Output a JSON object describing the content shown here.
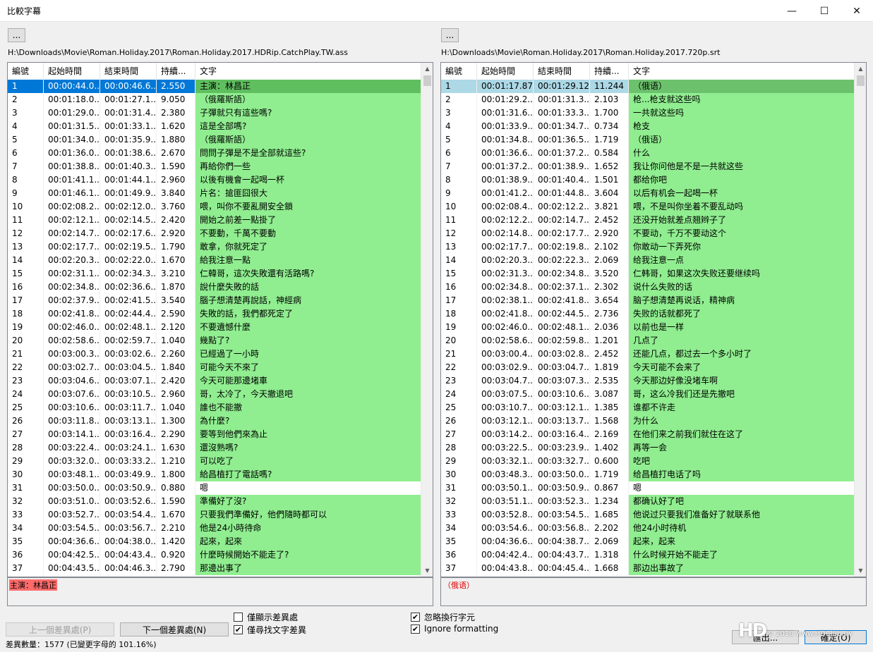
{
  "window": {
    "title": "比較字幕",
    "minimize": "—",
    "maximize": "☐",
    "close": "✕"
  },
  "left": {
    "browse_label": "...",
    "path": "H:\\Downloads\\Movie\\Roman.Holiday.2017\\Roman.Holiday.2017.HDRip.CatchPlay.TW.ass",
    "columns": [
      "編號",
      "起始時間",
      "結束時間",
      "持續...",
      "文字"
    ],
    "rows": [
      [
        "1",
        "00:00:44.0...",
        "00:00:46.6...",
        "2.550",
        "主演：林昌正"
      ],
      [
        "2",
        "00:01:18.0...",
        "00:01:27.1...",
        "9.050",
        "（俄羅斯語）"
      ],
      [
        "3",
        "00:01:29.0...",
        "00:01:31.4...",
        "2.380",
        "子彈就只有這些嗎?"
      ],
      [
        "4",
        "00:01:31.5...",
        "00:01:33.1...",
        "1.620",
        "這是全部嗎?"
      ],
      [
        "5",
        "00:01:34.0...",
        "00:01:35.9...",
        "1.880",
        "（俄羅斯語）"
      ],
      [
        "6",
        "00:01:36.0...",
        "00:01:38.6...",
        "2.670",
        "問問子彈是不是全部就這些?"
      ],
      [
        "7",
        "00:01:38.8...",
        "00:01:40.3...",
        "1.590",
        "再給你們一些"
      ],
      [
        "8",
        "00:01:41.1...",
        "00:01:44.1...",
        "2.960",
        "以後有機會一起喝一杯"
      ],
      [
        "9",
        "00:01:46.1...",
        "00:01:49.9...",
        "3.840",
        "片名：搶匪囧很大"
      ],
      [
        "10",
        "00:02:08.2...",
        "00:02:12.0...",
        "3.760",
        "喂，叫你不要亂開安全鎖"
      ],
      [
        "11",
        "00:02:12.1...",
        "00:02:14.5...",
        "2.420",
        "開始之前差一點掛了"
      ],
      [
        "12",
        "00:02:14.7...",
        "00:02:17.6...",
        "2.920",
        "不要動，千萬不要動"
      ],
      [
        "13",
        "00:02:17.7...",
        "00:02:19.5...",
        "1.790",
        "敢拿，你就死定了"
      ],
      [
        "14",
        "00:02:20.3...",
        "00:02:22.0...",
        "1.670",
        "給我注意一點"
      ],
      [
        "15",
        "00:02:31.1...",
        "00:02:34.3...",
        "3.210",
        "仁韓哥，這次失敗還有活路嗎?"
      ],
      [
        "16",
        "00:02:34.8...",
        "00:02:36.6...",
        "1.870",
        "說什麼失敗的話"
      ],
      [
        "17",
        "00:02:37.9...",
        "00:02:41.5...",
        "3.540",
        "腦子想清楚再說話，神經病"
      ],
      [
        "18",
        "00:02:41.8...",
        "00:02:44.4...",
        "2.590",
        "失敗的話，我們都死定了"
      ],
      [
        "19",
        "00:02:46.0...",
        "00:02:48.1...",
        "2.120",
        "不要遺憾什麼"
      ],
      [
        "20",
        "00:02:58.6...",
        "00:02:59.7...",
        "1.040",
        "幾點了?"
      ],
      [
        "21",
        "00:03:00.3...",
        "00:03:02.6...",
        "2.260",
        "已經過了一小時"
      ],
      [
        "22",
        "00:03:02.7...",
        "00:03:04.5...",
        "1.840",
        "可能今天不來了"
      ],
      [
        "23",
        "00:03:04.6...",
        "00:03:07.1...",
        "2.420",
        "今天可能那邊堵車"
      ],
      [
        "24",
        "00:03:07.6...",
        "00:03:10.5...",
        "2.960",
        "哥，太冷了，今天撤退吧"
      ],
      [
        "25",
        "00:03:10.6...",
        "00:03:11.7...",
        "1.040",
        "誰也不能撤"
      ],
      [
        "26",
        "00:03:11.8...",
        "00:03:13.1...",
        "1.300",
        "為什麼?"
      ],
      [
        "27",
        "00:03:14.1...",
        "00:03:16.4...",
        "2.290",
        "要等到他們來為止"
      ],
      [
        "28",
        "00:03:22.4...",
        "00:03:24.1...",
        "1.630",
        "還沒熟嗎?"
      ],
      [
        "29",
        "00:03:32.0...",
        "00:03:33.2...",
        "1.210",
        "可以吃了"
      ],
      [
        "30",
        "00:03:48.1...",
        "00:03:49.9...",
        "1.800",
        "給昌植打了電話嗎?"
      ],
      [
        "31",
        "00:03:50.0...",
        "00:03:50.9...",
        "0.880",
        "嗯"
      ],
      [
        "32",
        "00:03:51.0...",
        "00:03:52.6...",
        "1.590",
        "準備好了沒?"
      ],
      [
        "33",
        "00:03:52.7...",
        "00:03:54.4...",
        "1.670",
        "只要我們準備好，他們隨時都可以"
      ],
      [
        "34",
        "00:03:54.5...",
        "00:03:56.7...",
        "2.210",
        "他是24小時待命"
      ],
      [
        "35",
        "00:04:36.6...",
        "00:04:38.0...",
        "1.420",
        "起來，起來"
      ],
      [
        "36",
        "00:04:42.5...",
        "00:04:43.4...",
        "0.920",
        "什麼時候開始不能走了?"
      ],
      [
        "37",
        "00:04:43.5...",
        "00:04:46.3...",
        "2.790",
        "那邊出事了"
      ]
    ],
    "preview": "主演：林昌正"
  },
  "right": {
    "browse_label": "...",
    "path": "H:\\Downloads\\Movie\\Roman.Holiday.2017\\Roman.Holiday.2017.720p.srt",
    "columns": [
      "編號",
      "起始時間",
      "結束時間",
      "持續...",
      "文字"
    ],
    "rows": [
      [
        "1",
        "00:01:17.878",
        "00:01:29.122",
        "11.244",
        "（俄语）"
      ],
      [
        "2",
        "00:01:29.2...",
        "00:01:31.3...",
        "2.103",
        "枪...枪支就这些吗"
      ],
      [
        "3",
        "00:01:31.6...",
        "00:01:33.3...",
        "1.700",
        "一共就这些吗"
      ],
      [
        "4",
        "00:01:33.9...",
        "00:01:34.7...",
        "0.734",
        "枪支"
      ],
      [
        "5",
        "00:01:34.8...",
        "00:01:36.5...",
        "1.719",
        "（俄语）"
      ],
      [
        "6",
        "00:01:36.6...",
        "00:01:37.2...",
        "0.584",
        "什么"
      ],
      [
        "7",
        "00:01:37.2...",
        "00:01:38.9...",
        "1.652",
        "我让你问他是不是一共就这些"
      ],
      [
        "8",
        "00:01:38.9...",
        "00:01:40.4...",
        "1.501",
        "都给你吧"
      ],
      [
        "9",
        "00:01:41.2...",
        "00:01:44.8...",
        "3.604",
        "以后有机会一起喝一杯"
      ],
      [
        "10",
        "00:02:08.4...",
        "00:02:12.2...",
        "3.821",
        "喂，不是叫你坐着不要乱动吗"
      ],
      [
        "11",
        "00:02:12.2...",
        "00:02:14.7...",
        "2.452",
        "还没开始就差点翘辫子了"
      ],
      [
        "12",
        "00:02:14.8...",
        "00:02:17.7...",
        "2.920",
        "不要动，千万不要动这个"
      ],
      [
        "13",
        "00:02:17.7...",
        "00:02:19.8...",
        "2.102",
        "你敢动一下弄死你"
      ],
      [
        "14",
        "00:02:20.3...",
        "00:02:22.3...",
        "2.069",
        "给我注意一点"
      ],
      [
        "15",
        "00:02:31.3...",
        "00:02:34.8...",
        "3.520",
        "仁韩哥，如果这次失败还要继续吗"
      ],
      [
        "16",
        "00:02:34.8...",
        "00:02:37.1...",
        "2.302",
        "说什么失败的话"
      ],
      [
        "17",
        "00:02:38.1...",
        "00:02:41.8...",
        "3.654",
        "脑子想清楚再说话，精神病"
      ],
      [
        "18",
        "00:02:41.8...",
        "00:02:44.5...",
        "2.736",
        "失败的话就都死了"
      ],
      [
        "19",
        "00:02:46.0...",
        "00:02:48.1...",
        "2.036",
        "以前也是一样"
      ],
      [
        "20",
        "00:02:58.6...",
        "00:02:59.8...",
        "1.201",
        "几点了"
      ],
      [
        "21",
        "00:03:00.4...",
        "00:03:02.8...",
        "2.452",
        "还能几点，都过去一个多小时了"
      ],
      [
        "22",
        "00:03:02.9...",
        "00:03:04.7...",
        "1.819",
        "今天可能不会来了"
      ],
      [
        "23",
        "00:03:04.7...",
        "00:03:07.3...",
        "2.535",
        "今天那边好像没堵车啊"
      ],
      [
        "24",
        "00:03:07.5...",
        "00:03:10.6...",
        "3.087",
        "哥，这么冷我们还是先撤吧"
      ],
      [
        "25",
        "00:03:10.7...",
        "00:03:12.1...",
        "1.385",
        "谁都不许走"
      ],
      [
        "26",
        "00:03:12.1...",
        "00:03:13.7...",
        "1.568",
        "为什么"
      ],
      [
        "27",
        "00:03:14.2...",
        "00:03:16.4...",
        "2.169",
        "在他们来之前我们就住在这了"
      ],
      [
        "28",
        "00:03:22.5...",
        "00:03:23.9...",
        "1.402",
        "再等一会"
      ],
      [
        "29",
        "00:03:32.1...",
        "00:03:32.7...",
        "0.600",
        "吃吧"
      ],
      [
        "30",
        "00:03:48.3...",
        "00:03:50.0...",
        "1.719",
        "给昌植打电话了吗"
      ],
      [
        "31",
        "00:03:50.1...",
        "00:03:50.9...",
        "0.867",
        "嗯"
      ],
      [
        "32",
        "00:03:51.1...",
        "00:03:52.3...",
        "1.234",
        "都确认好了吧"
      ],
      [
        "33",
        "00:03:52.8...",
        "00:03:54.5...",
        "1.685",
        "他说过只要我们准备好了就联系他"
      ],
      [
        "34",
        "00:03:54.6...",
        "00:03:56.8...",
        "2.202",
        "他24小时待机"
      ],
      [
        "35",
        "00:04:36.6...",
        "00:04:38.7...",
        "2.069",
        "起来，起来"
      ],
      [
        "36",
        "00:04:42.4...",
        "00:04:43.7...",
        "1.318",
        "什么时候开始不能走了"
      ],
      [
        "37",
        "00:04:43.8...",
        "00:04:45.4...",
        "1.668",
        "那边出事故了"
      ]
    ],
    "preview": "（俄语）"
  },
  "nodiff_row": "31",
  "buttons": {
    "prev_diff": "上一個差異處(P)",
    "next_diff": "下一個差異處(N)",
    "export": "匯出...",
    "ok": "確定(O)"
  },
  "options": {
    "only_diffs": {
      "label": "僅顯示差異處",
      "checked": false
    },
    "only_text_diffs": {
      "label": "僅尋找文字差異",
      "checked": true
    },
    "ignore_line_breaks": {
      "label": "忽略換行字元",
      "checked": true
    },
    "ignore_formatting": {
      "label": "Ignore formatting",
      "checked": true
    }
  },
  "status": "差異數量：1577 (已變更字母的 101.16%)",
  "watermark": {
    "logo": "HD",
    "text": "© 2018 www.HDClub.tw"
  },
  "colors": {
    "diff_row": "#90ee90",
    "selection_left": "#0078d7",
    "selection_right": "#add8e6",
    "preview_highlight": "#ff6b6b"
  }
}
